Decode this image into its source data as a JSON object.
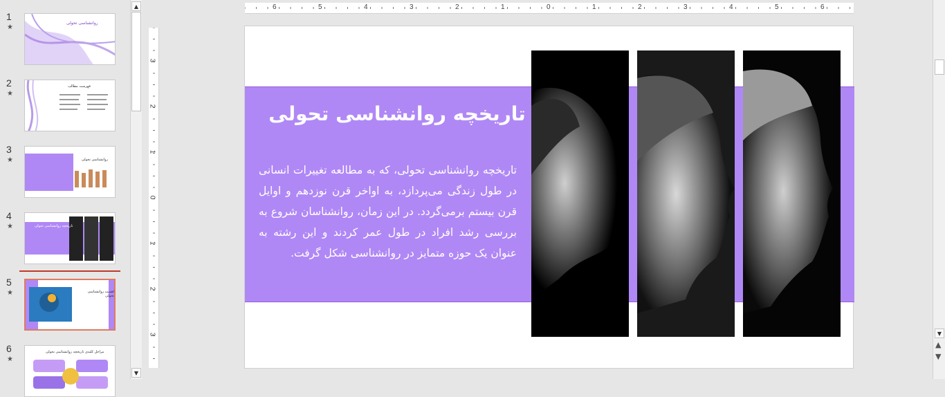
{
  "thumbnails": [
    {
      "number": "1",
      "star": "★",
      "title": "روانشناسی تحولی"
    },
    {
      "number": "2",
      "star": "★",
      "title": "فهرست مطالب"
    },
    {
      "number": "3",
      "star": "★",
      "title": "روانشناسی تحولی"
    },
    {
      "number": "4",
      "star": "★",
      "title": "تاریخچه روانشناسی تحولی"
    },
    {
      "number": "5",
      "star": "★",
      "title": "اهمیت روانشناسی تحولی"
    },
    {
      "number": "6",
      "star": "★",
      "title": "مراحل کلیدی تاریخچه روانشناسی تحولی"
    }
  ],
  "ruler": {
    "horizontal": [
      "6",
      "5",
      "4",
      "3",
      "2",
      "1",
      "0",
      "1",
      "2",
      "3",
      "4",
      "5",
      "6"
    ],
    "vertical": [
      "3",
      "2",
      "1",
      "0",
      "1",
      "2",
      "3"
    ]
  },
  "slide": {
    "title": "تاریخچه روانشناسی تحولی",
    "body": "تاریخچه روانشناسی تحولی، که به مطالعه تغییرات انسانی در طول زندگی می‌پردازد، به اواخر قرن نوزدهم و اوایل قرن بیستم برمی‌گردد. در این زمان، روانشناسان شروع به بررسی رشد افراد در طول عمر کردند و این رشته به عنوان یک حوزه متمایز در روانشناسی شکل گرفت.",
    "accent_color": "#b088f5"
  },
  "icons": {
    "scroll_up": "▲",
    "scroll_down": "▼",
    "prev_slide": "▲",
    "next_slide": "▼"
  }
}
